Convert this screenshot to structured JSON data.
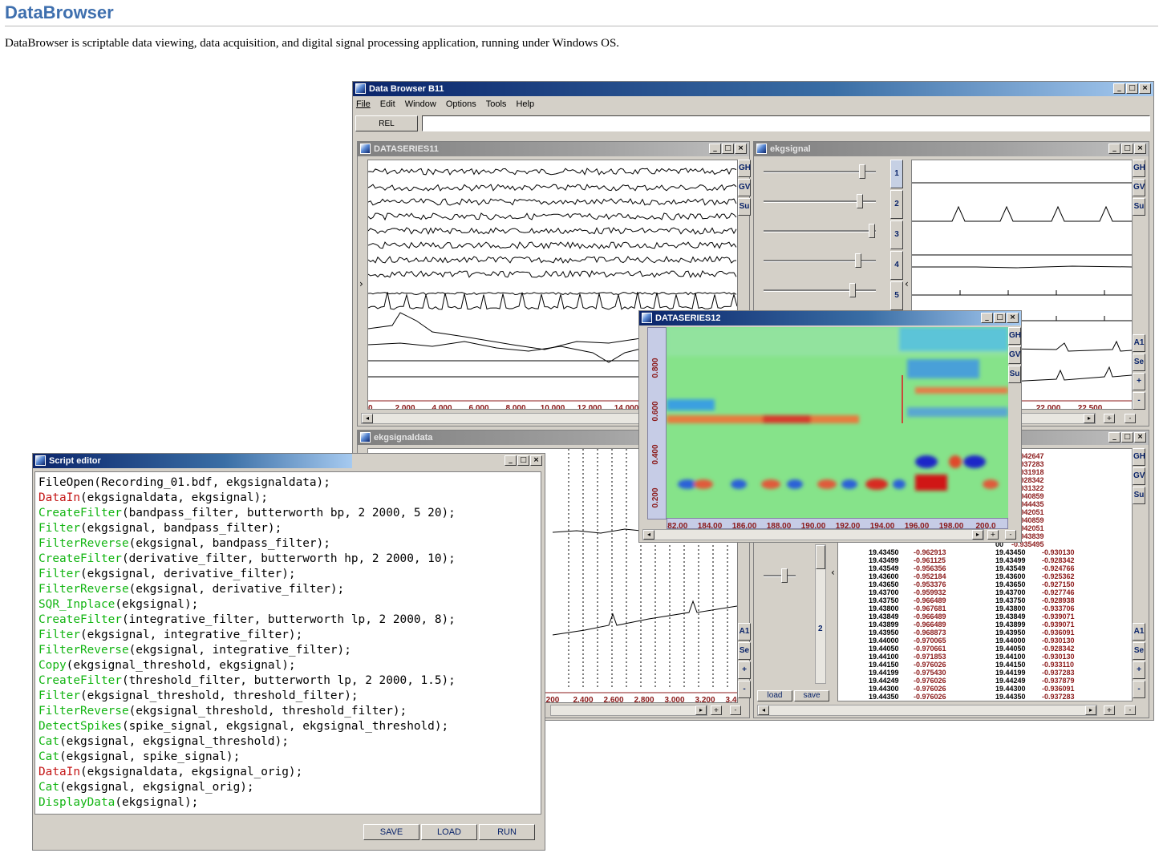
{
  "page": {
    "title": "DataBrowser",
    "description": "DataBrowser is scriptable data viewing, data acquisition, and digital signal processing application, running under Windows OS."
  },
  "main_window": {
    "title": "Data Browser B11",
    "menu": [
      "File",
      "Edit",
      "Window",
      "Options",
      "Tools",
      "Help"
    ],
    "rel_label": "REL",
    "command_value": ""
  },
  "dataseries11": {
    "title": "DATASERIES11",
    "side_buttons": [
      "GH",
      "GV",
      "Su"
    ],
    "x_ticks": [
      "00",
      "2.000",
      "4.000",
      "6.000",
      "8.000",
      "10.000",
      "12.000",
      "14.000"
    ]
  },
  "ekgsignal": {
    "title": "ekgsignal",
    "channels": [
      "1",
      "2",
      "3",
      "4",
      "5"
    ],
    "slider_levels": [
      0.9,
      0.88,
      0.99,
      0.86,
      0.81
    ],
    "side_buttons": [
      "GH",
      "GV",
      "Su"
    ],
    "side_buttons_lower": [
      "A1",
      "Se",
      "+",
      "-"
    ],
    "x_ticks": [
      "22.000",
      "22.500"
    ]
  },
  "dataseries12": {
    "title": "DATASERIES12",
    "side_buttons": [
      "GH",
      "GV",
      "Su"
    ],
    "side_buttons_lower": [
      "A1",
      "Se",
      "+",
      "-"
    ],
    "x_ticks": [
      "182.00",
      "184.00",
      "186.00",
      "188.00",
      "190.00",
      "192.00",
      "194.00",
      "196.00",
      "198.00",
      "200.0"
    ],
    "y_ticks": [
      "0.800",
      "0.600",
      "0.400",
      "0.200"
    ]
  },
  "ekgsignaldata": {
    "title": "ekgsignaldata",
    "side_buttons": [
      "A1",
      "Se",
      "+",
      "-"
    ],
    "x_ticks": [
      "200",
      "2.400",
      "2.600",
      "2.800",
      "3.000",
      "3.200",
      "3.400"
    ]
  },
  "table_window": {
    "side_buttons": [
      "GH",
      "GV",
      "Su"
    ],
    "side_buttons_lower": [
      "A1",
      "Se",
      "+",
      "-"
    ],
    "channel_label": "2",
    "load_label": "load",
    "save_label": "save",
    "top_rows": [
      {
        "t1": "49",
        "v1": "",
        "t2": "",
        "v2": "-0.942647"
      },
      {
        "t1": "",
        "v1": "",
        "t2": "00",
        "v2": "-0.937283"
      },
      {
        "t1": "",
        "v1": "",
        "t2": "49",
        "v2": "-0.931918"
      },
      {
        "t1": "",
        "v1": "",
        "t2": "00",
        "v2": "-0.928342"
      },
      {
        "t1": "",
        "v1": "",
        "t2": "50",
        "v2": "-0.931322"
      },
      {
        "t1": "",
        "v1": "",
        "t2": "00",
        "v2": "-0.940859"
      },
      {
        "t1": "",
        "v1": "",
        "t2": "50",
        "v2": "-0.944435"
      },
      {
        "t1": "",
        "v1": "",
        "t2": "00",
        "v2": "-0.942051"
      },
      {
        "t1": "",
        "v1": "",
        "t2": "50",
        "v2": "-0.940859"
      },
      {
        "t1": "",
        "v1": "",
        "t2": "00",
        "v2": "-0.942051"
      },
      {
        "t1": "",
        "v1": "",
        "t2": "49",
        "v2": "-0.943839"
      },
      {
        "t1": "",
        "v1": "",
        "t2": "00",
        "v2": "-0.935495"
      }
    ],
    "rows": [
      {
        "t1": "19.43450",
        "v1": "-0.962913",
        "t2": "19.43450",
        "v2": "-0.930130"
      },
      {
        "t1": "19.43499",
        "v1": "-0.961125",
        "t2": "19.43499",
        "v2": "-0.928342"
      },
      {
        "t1": "19.43549",
        "v1": "-0.956356",
        "t2": "19.43549",
        "v2": "-0.924766"
      },
      {
        "t1": "19.43600",
        "v1": "-0.952184",
        "t2": "19.43600",
        "v2": "-0.925362"
      },
      {
        "t1": "19.43650",
        "v1": "-0.953376",
        "t2": "19.43650",
        "v2": "-0.927150"
      },
      {
        "t1": "19.43700",
        "v1": "-0.959932",
        "t2": "19.43700",
        "v2": "-0.927746"
      },
      {
        "t1": "19.43750",
        "v1": "-0.966489",
        "t2": "19.43750",
        "v2": "-0.928938"
      },
      {
        "t1": "19.43800",
        "v1": "-0.967681",
        "t2": "19.43800",
        "v2": "-0.933706"
      },
      {
        "t1": "19.43849",
        "v1": "-0.966489",
        "t2": "19.43849",
        "v2": "-0.939071"
      },
      {
        "t1": "19.43899",
        "v1": "-0.966489",
        "t2": "19.43899",
        "v2": "-0.939071"
      },
      {
        "t1": "19.43950",
        "v1": "-0.968873",
        "t2": "19.43950",
        "v2": "-0.936091"
      },
      {
        "t1": "19.44000",
        "v1": "-0.970065",
        "t2": "19.44000",
        "v2": "-0.930130"
      },
      {
        "t1": "19.44050",
        "v1": "-0.970661",
        "t2": "19.44050",
        "v2": "-0.928342"
      },
      {
        "t1": "19.44100",
        "v1": "-0.971853",
        "t2": "19.44100",
        "v2": "-0.930130"
      },
      {
        "t1": "19.44150",
        "v1": "-0.976026",
        "t2": "19.44150",
        "v2": "-0.933110"
      },
      {
        "t1": "19.44199",
        "v1": "-0.975430",
        "t2": "19.44199",
        "v2": "-0.937283"
      },
      {
        "t1": "19.44249",
        "v1": "-0.976026",
        "t2": "19.44249",
        "v2": "-0.937879"
      },
      {
        "t1": "19.44300",
        "v1": "-0.976026",
        "t2": "19.44300",
        "v2": "-0.936091"
      },
      {
        "t1": "19.44350",
        "v1": "-0.976026",
        "t2": "19.44350",
        "v2": "-0.937283"
      },
      {
        "t1": "19.44400",
        "v1": "-0.981390",
        "t2": "19.44400",
        "v2": "-0.939071"
      }
    ]
  },
  "script_editor": {
    "title": "Script editor",
    "lines": [
      {
        "fn": "",
        "args": "FileOpen(Recording_01.bdf, ekgsignaldata);",
        "c": "plain"
      },
      {
        "fn": "DataIn",
        "args": "(ekgsignaldata, ekgsignal);",
        "c": "red"
      },
      {
        "fn": "CreateFilter",
        "args": "(bandpass_filter, butterworth bp, 2 2000, 5 20);",
        "c": "green"
      },
      {
        "fn": "Filter",
        "args": "(ekgsignal, bandpass_filter);",
        "c": "green"
      },
      {
        "fn": "FilterReverse",
        "args": "(ekgsignal, bandpass_filter);",
        "c": "green"
      },
      {
        "fn": "CreateFilter",
        "args": "(derivative_filter, butterworth hp, 2 2000, 10);",
        "c": "green"
      },
      {
        "fn": "Filter",
        "args": "(ekgsignal, derivative_filter);",
        "c": "green"
      },
      {
        "fn": "FilterReverse",
        "args": "(ekgsignal, derivative_filter);",
        "c": "green"
      },
      {
        "fn": "SQR_Inplace",
        "args": "(ekgsignal);",
        "c": "green"
      },
      {
        "fn": "CreateFilter",
        "args": "(integrative_filter, butterworth lp, 2 2000, 8);",
        "c": "green"
      },
      {
        "fn": "Filter",
        "args": "(ekgsignal, integrative_filter);",
        "c": "green"
      },
      {
        "fn": "FilterReverse",
        "args": "(ekgsignal, integrative_filter);",
        "c": "green"
      },
      {
        "fn": "Copy",
        "args": "(ekgsignal_threshold, ekgsignal);",
        "c": "green"
      },
      {
        "fn": "CreateFilter",
        "args": "(threshold_filter, butterworth lp, 2 2000, 1.5);",
        "c": "green"
      },
      {
        "fn": "Filter",
        "args": "(ekgsignal_threshold, threshold_filter);",
        "c": "green"
      },
      {
        "fn": "FilterReverse",
        "args": "(ekgsignal_threshold, threshold_filter);",
        "c": "green"
      },
      {
        "fn": "DetectSpikes",
        "args": "(spike_signal, ekgsignal, ekgsignal_threshold);",
        "c": "green"
      },
      {
        "fn": "Cat",
        "args": "(ekgsignal, ekgsignal_threshold);",
        "c": "green"
      },
      {
        "fn": "Cat",
        "args": "(ekgsignal, spike_signal);",
        "c": "green"
      },
      {
        "fn": "DataIn",
        "args": "(ekgsignaldata, ekgsignal_orig);",
        "c": "red"
      },
      {
        "fn": "Cat",
        "args": "(ekgsignal, ekgsignal_orig);",
        "c": "green"
      },
      {
        "fn": "DisplayData",
        "args": "(ekgsignal);",
        "c": "green"
      }
    ],
    "buttons": {
      "save": "SAVE",
      "load": "LOAD",
      "run": "RUN"
    }
  },
  "colors": {
    "title_blue": "#3e6fae",
    "active_title": "#0a246a",
    "code_green": "#12b512",
    "code_red": "#c41515",
    "tick_red": "#8b1a1a"
  }
}
